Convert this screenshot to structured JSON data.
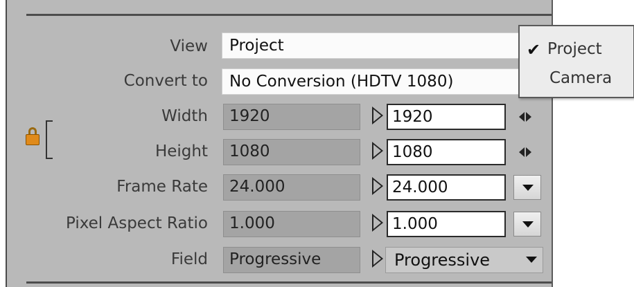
{
  "rows": {
    "view": {
      "label": "View",
      "value": "Project"
    },
    "convert_to": {
      "label": "Convert to",
      "value": "No Conversion (HDTV 1080)"
    },
    "width": {
      "label": "Width",
      "source": "1920",
      "target": "1920"
    },
    "height": {
      "label": "Height",
      "source": "1080",
      "target": "1080"
    },
    "frame_rate": {
      "label": "Frame Rate",
      "source": "24.000",
      "target": "24.000"
    },
    "pixel_aspect_ratio": {
      "label": "Pixel Aspect Ratio",
      "source": "1.000",
      "target": "1.000"
    },
    "field": {
      "label": "Field",
      "source": "Progressive",
      "target": "Progressive"
    }
  },
  "view_menu": {
    "items": [
      "Project",
      "Camera"
    ],
    "selected": "Project"
  },
  "icons": {
    "lock": "lock-icon",
    "stepper": "left-right-stepper-icon",
    "dropdown": "chevron-down-icon",
    "copy_arrow": "triangle-right-icon",
    "check": "checkmark-icon"
  },
  "colors": {
    "panel_bg": "#b9b9b9",
    "lock_orange": "#e08a1a"
  }
}
